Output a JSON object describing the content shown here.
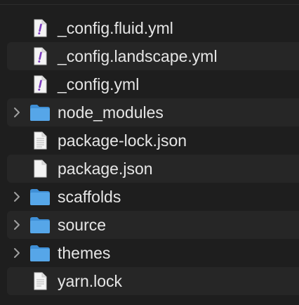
{
  "finder": {
    "items": [
      {
        "name": "_config.fluid.yml",
        "kind": "yml",
        "expandable": false
      },
      {
        "name": "_config.landscape.yml",
        "kind": "yml",
        "expandable": false
      },
      {
        "name": "_config.yml",
        "kind": "yml",
        "expandable": false
      },
      {
        "name": "node_modules",
        "kind": "folder",
        "expandable": true
      },
      {
        "name": "package-lock.json",
        "kind": "doc",
        "expandable": false
      },
      {
        "name": "package.json",
        "kind": "doc",
        "expandable": false
      },
      {
        "name": "scaffolds",
        "kind": "folder",
        "expandable": true
      },
      {
        "name": "source",
        "kind": "folder",
        "expandable": true
      },
      {
        "name": "themes",
        "kind": "folder",
        "expandable": true
      },
      {
        "name": "yarn.lock",
        "kind": "doc",
        "expandable": false
      }
    ]
  },
  "colors": {
    "background": "#1e1e1e",
    "stripe": "#262626",
    "text": "#e6e6e6",
    "folder": "#56a6e8",
    "yml_mark": "#7d3bbf",
    "chevron": "#a0a0a0"
  },
  "icons": {
    "yml": "yml-file-icon",
    "folder": "folder-icon",
    "doc": "document-icon",
    "disclosure": "chevron-right-icon"
  }
}
